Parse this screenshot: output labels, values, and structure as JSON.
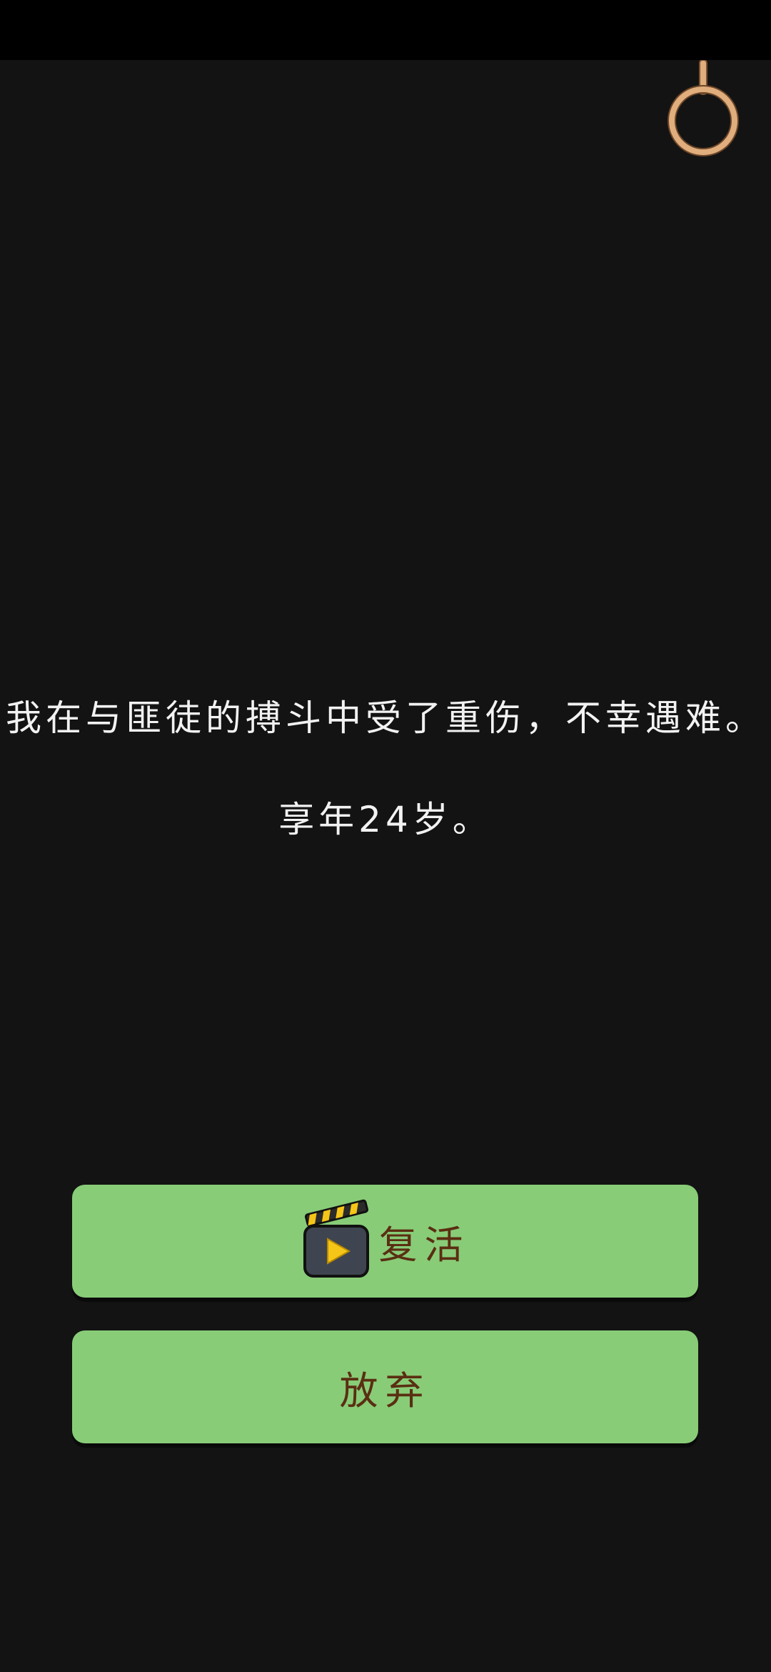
{
  "story": {
    "line1": "我在与匪徒的搏斗中受了重伤，不幸遇难。",
    "line2": "享年24岁。"
  },
  "buttons": {
    "revive_label": "复活",
    "give_up_label": "放弃"
  },
  "icons": {
    "revive": "video-clapper-play-icon",
    "ornament": "hanging-ring-icon"
  },
  "colors": {
    "background": "#131313",
    "button": "#88cc77",
    "button_text": "#5a2e12",
    "ring": "#e0ad7c",
    "clapper_stripe": "#f5c518",
    "play": "#f5c518"
  }
}
